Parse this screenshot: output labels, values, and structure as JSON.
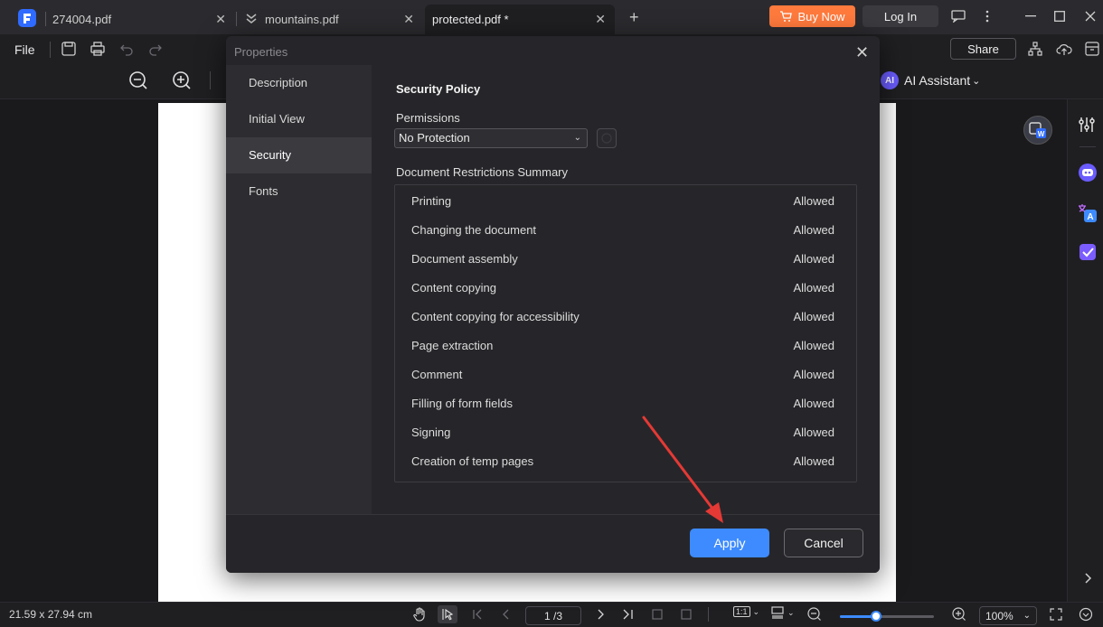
{
  "tabs": [
    {
      "label": "274004.pdf",
      "close": "✕"
    },
    {
      "label": "mountains.pdf",
      "close": "✕"
    },
    {
      "label": "protected.pdf *",
      "close": "✕"
    }
  ],
  "new_tab": "+",
  "header": {
    "buy_now": "Buy Now",
    "log_in": "Log In"
  },
  "toolbar": {
    "file": "File",
    "share": "Share"
  },
  "ai": {
    "badge": "AI",
    "label": "AI Assistant",
    "caret": "⌄"
  },
  "dialog": {
    "title": "Properties",
    "close": "✕",
    "sidebar": [
      {
        "label": "Description"
      },
      {
        "label": "Initial View"
      },
      {
        "label": "Security"
      },
      {
        "label": "Fonts"
      }
    ],
    "active_index": 2,
    "security_heading": "Security Policy",
    "permissions_label": "Permissions",
    "permissions_value": "No Protection",
    "summary_label": "Document Restrictions Summary",
    "restrictions": [
      {
        "name": "Printing",
        "value": "Allowed"
      },
      {
        "name": "Changing the document",
        "value": "Allowed"
      },
      {
        "name": "Document assembly",
        "value": "Allowed"
      },
      {
        "name": "Content copying",
        "value": "Allowed"
      },
      {
        "name": "Content copying for accessibility",
        "value": "Allowed"
      },
      {
        "name": "Page extraction",
        "value": "Allowed"
      },
      {
        "name": "Comment",
        "value": "Allowed"
      },
      {
        "name": "Filling of form fields",
        "value": "Allowed"
      },
      {
        "name": "Signing",
        "value": "Allowed"
      },
      {
        "name": "Creation of temp pages",
        "value": "Allowed"
      }
    ],
    "apply": "Apply",
    "cancel": "Cancel"
  },
  "status": {
    "page_size": "21.59 x 27.94 cm",
    "page_indicator": "1 /3",
    "zoom": "100%",
    "zoom_level": 0.38,
    "fit_label": "1:1"
  },
  "colors": {
    "accent": "#3d8bff",
    "buy_now": "#ff7a3d",
    "annotation_arrow": "#e53935"
  }
}
